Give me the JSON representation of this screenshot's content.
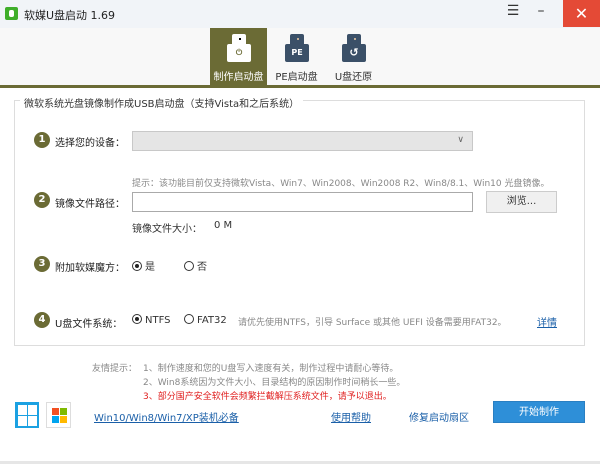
{
  "window": {
    "title": "软媒U盘启动 1.69",
    "menu_icon": "hamburger-icon",
    "minimize_icon": "minimize-icon",
    "close_icon": "close-icon",
    "menu": "☰",
    "min": "–",
    "close": "✕"
  },
  "tabs": [
    {
      "label": "制作启动盘",
      "icon": "usb-power-icon",
      "active": true
    },
    {
      "label": "PE启动盘",
      "icon": "usb-pe-icon",
      "badge": "PE"
    },
    {
      "label": "U盘还原",
      "icon": "usb-restore-icon",
      "badge": "↺"
    }
  ],
  "group": {
    "legend": "微软系统光盘镜像制作成USB启动盘（支持Vista和之后系统）"
  },
  "steps": {
    "s1": {
      "num": "1",
      "label": "选择您的设备：",
      "value": ""
    },
    "hint": "提示：该功能目前仅支持微软Vista、Win7、Win2008、Win2008 R2、Win8/8.1、Win10 光盘镜像。",
    "s2": {
      "num": "2",
      "label": "镜像文件路径：",
      "value": "",
      "browse": "浏览...",
      "size_label": "镜像文件大小：",
      "size_value": "0 M"
    },
    "s3": {
      "num": "3",
      "label": "附加软媒魔方：",
      "yes": "是",
      "no": "否",
      "selected": "是"
    },
    "s4": {
      "num": "4",
      "label": "U盘文件系统：",
      "ntfs": "NTFS",
      "fat32": "FAT32",
      "selected": "NTFS",
      "note": "请优先使用NTFS，引导 Surface 或其他 UEFI 设备需要用FAT32。",
      "details": "详情"
    }
  },
  "tips": {
    "prefix": "友情提示：",
    "t1": "1、制作速度和您的U盘写入速度有关，制作过程中请耐心等待。",
    "t2": "2、Win8系统因为文件大小、目录结构的原因制作时间稍长一些。",
    "t3": "3、部分国产安全软件会频繁拦截解压系统文件，请予以退出。",
    "warn_color": "#e02020"
  },
  "footer": {
    "link_install": "Win10/Win8/Win7/XP装机必备",
    "link_help": "使用帮助",
    "link_repair": "修复启动扇区",
    "start": "开始制作"
  },
  "colors": {
    "accent": "#6b6b35",
    "button": "#2e8fd8",
    "close": "#e44a36"
  }
}
